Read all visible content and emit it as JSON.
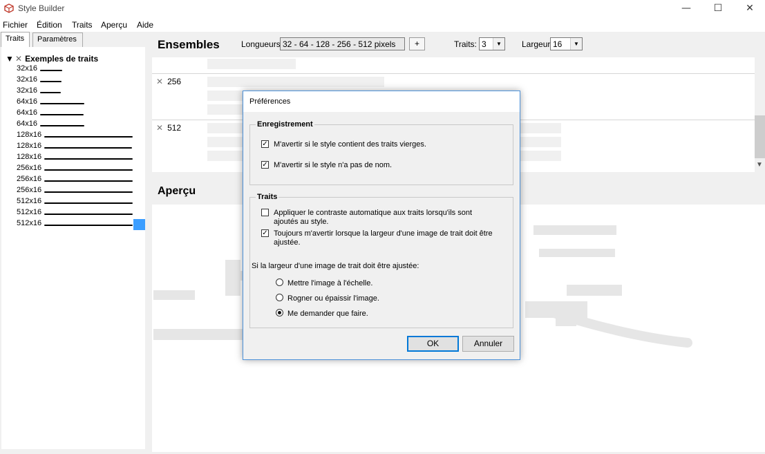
{
  "window": {
    "title": "Style Builder",
    "minimize": "—",
    "maximize": "☐",
    "close": "✕"
  },
  "menu": [
    "Fichier",
    "Édition",
    "Traits",
    "Aperçu",
    "Aide"
  ],
  "tabs": [
    "Traits",
    "Paramètres"
  ],
  "tree": {
    "root": "Exemples de traits",
    "expand_glyph": "▼",
    "items": [
      "32x16",
      "32x16",
      "32x16",
      "64x16",
      "64x16",
      "64x16",
      "128x16",
      "128x16",
      "128x16",
      "256x16",
      "256x16",
      "256x16",
      "512x16",
      "512x16",
      "512x16"
    ]
  },
  "ensembles": {
    "title": "Ensembles",
    "longueurs_label": "Longueurs:",
    "longueurs_value": "32 - 64 - 128 - 256 - 512 pixels",
    "add_button": "+",
    "traits_label": "Traits:",
    "traits_value": "3",
    "largeur_label": "Largeur:",
    "largeur_value": "16",
    "sets": [
      {
        "label": "256"
      },
      {
        "label": "512"
      }
    ]
  },
  "apercu": {
    "title": "Aperçu"
  },
  "dialog": {
    "title": "Préférences",
    "enregistrement": {
      "legend": "Enregistrement",
      "options": [
        {
          "label": "M'avertir si le style contient des traits vierges.",
          "checked": true
        },
        {
          "label": "M'avertir si le style n'a pas de nom.",
          "checked": true
        }
      ]
    },
    "traits": {
      "legend": "Traits",
      "options": [
        {
          "label": "Appliquer le contraste automatique aux traits lorsqu'ils sont ajoutés au style.",
          "checked": false
        },
        {
          "label": "Toujours m'avertir lorsque la largeur d'une image de trait doit être ajustée.",
          "checked": true
        }
      ],
      "question": "Si la largeur d'une image de trait doit être ajustée:",
      "radios": [
        {
          "label": "Mettre l'image à l'échelle.",
          "selected": false
        },
        {
          "label": "Rogner ou épaissir l'image.",
          "selected": false
        },
        {
          "label": "Me demander que faire.",
          "selected": true
        }
      ]
    },
    "ok": "OK",
    "cancel": "Annuler"
  }
}
